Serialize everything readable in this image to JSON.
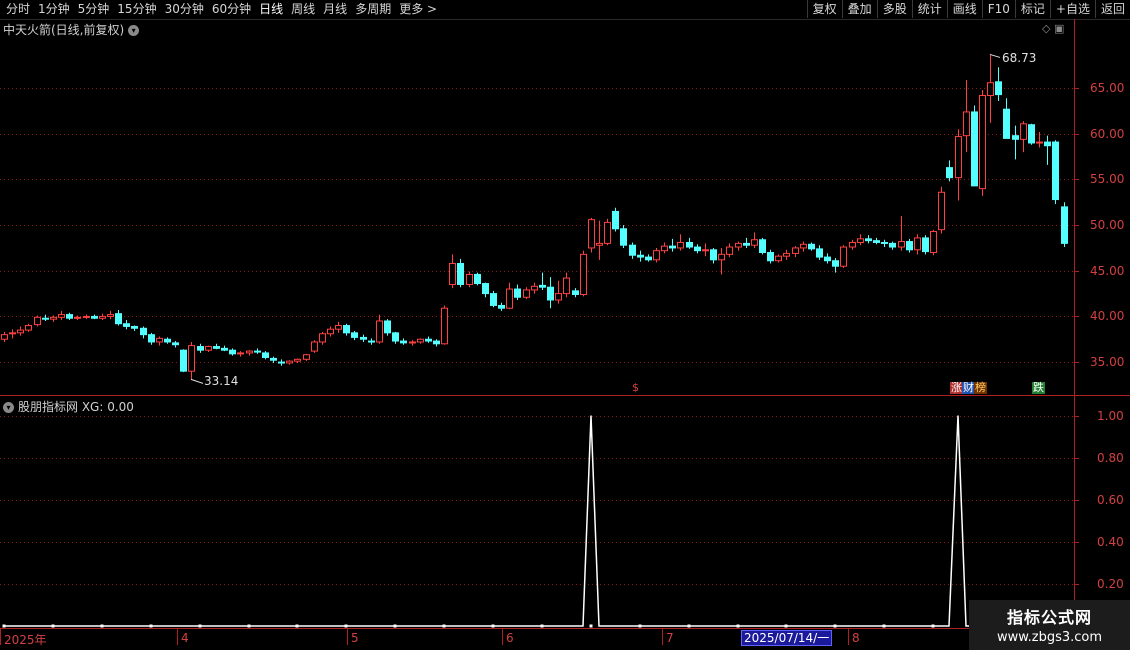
{
  "toolbar": {
    "periods": [
      "分时",
      "1分钟",
      "5分钟",
      "15分钟",
      "30分钟",
      "60分钟",
      "日线",
      "周线",
      "月线",
      "多周期",
      "更多 >"
    ],
    "active_period": "日线",
    "right_buttons": [
      "复权",
      "叠加",
      "多股",
      "统计",
      "画线",
      "F10",
      "标记",
      "+自选",
      "返回"
    ]
  },
  "main_chart": {
    "title": "中天火箭(日线,前复权)",
    "high_label": "68.73",
    "low_label": "33.14",
    "price_axis": [
      "65.00",
      "60.00",
      "55.00",
      "50.00",
      "45.00",
      "40.00",
      "35.00"
    ],
    "signals": [
      {
        "text": "$",
        "color": "#e04040"
      },
      {
        "text": "涨",
        "color": "#ffffff",
        "bg": "#b03030"
      },
      {
        "text": "财",
        "color": "#ffffff",
        "bg": "#2050b0"
      },
      {
        "text": "榜",
        "color": "#ffd060",
        "bg": "#703000"
      },
      {
        "text": "跌",
        "color": "#ffffff",
        "bg": "#208030"
      }
    ]
  },
  "indicator": {
    "title": "股朋指标网 XG: 0.00",
    "axis": [
      "1.00",
      "0.80",
      "0.60",
      "0.40",
      "0.20"
    ]
  },
  "x_axis": {
    "labels": [
      "2025年",
      "4",
      "5",
      "6",
      "7",
      "8"
    ],
    "cursor_date": "2025/07/14/一"
  },
  "watermark": {
    "line1": "指标公式网",
    "line2": "www.zbgs3.com"
  },
  "colors": {
    "up": "#ff4040",
    "down": "#54ffff",
    "grid": "#8a1a1a",
    "line": "#ffffff"
  },
  "chart_data": {
    "type": "candlestick",
    "ylim": [
      31.5,
      70.5
    ],
    "candles": [
      [
        37.5,
        38.3,
        37.2,
        38.0
      ],
      [
        38.1,
        38.6,
        37.6,
        38.2
      ],
      [
        38.2,
        38.9,
        37.9,
        38.5
      ],
      [
        38.5,
        39.2,
        38.3,
        39.0
      ],
      [
        39.1,
        40.1,
        38.9,
        39.9
      ],
      [
        39.8,
        40.2,
        39.5,
        39.7
      ],
      [
        39.7,
        40.1,
        39.4,
        39.9
      ],
      [
        39.9,
        40.6,
        39.6,
        40.2
      ],
      [
        40.2,
        40.4,
        39.6,
        39.8
      ],
      [
        39.8,
        40.1,
        39.6,
        39.9
      ],
      [
        39.9,
        40.2,
        39.7,
        40.0
      ],
      [
        40.0,
        40.2,
        39.7,
        39.8
      ],
      [
        39.8,
        40.3,
        39.6,
        40.0
      ],
      [
        40.0,
        40.6,
        39.7,
        40.2
      ],
      [
        40.3,
        40.7,
        39.0,
        39.2
      ],
      [
        39.2,
        39.6,
        38.6,
        38.9
      ],
      [
        38.9,
        39.0,
        38.4,
        38.7
      ],
      [
        38.7,
        38.9,
        37.6,
        38.0
      ],
      [
        38.0,
        38.2,
        36.9,
        37.2
      ],
      [
        37.2,
        37.8,
        36.8,
        37.6
      ],
      [
        37.5,
        37.7,
        37.0,
        37.2
      ],
      [
        37.1,
        37.3,
        36.6,
        36.9
      ],
      [
        36.3,
        36.4,
        33.9,
        34.0
      ],
      [
        34.0,
        37.2,
        33.1,
        36.8
      ],
      [
        36.7,
        37.0,
        36.0,
        36.3
      ],
      [
        36.3,
        36.8,
        36.1,
        36.7
      ],
      [
        36.7,
        37.0,
        36.4,
        36.5
      ],
      [
        36.5,
        36.8,
        36.2,
        36.3
      ],
      [
        36.3,
        36.5,
        35.7,
        35.9
      ],
      [
        35.9,
        36.2,
        35.6,
        36.0
      ],
      [
        36.0,
        36.3,
        35.7,
        36.2
      ],
      [
        36.2,
        36.5,
        35.9,
        36.1
      ],
      [
        36.0,
        36.2,
        35.3,
        35.5
      ],
      [
        35.4,
        35.6,
        34.9,
        35.2
      ],
      [
        35.0,
        35.3,
        34.6,
        34.9
      ],
      [
        34.9,
        35.2,
        34.7,
        35.1
      ],
      [
        35.1,
        35.4,
        34.9,
        35.3
      ],
      [
        35.3,
        35.9,
        35.1,
        35.8
      ],
      [
        36.2,
        37.4,
        36.0,
        37.2
      ],
      [
        37.2,
        38.3,
        36.9,
        38.1
      ],
      [
        38.1,
        38.9,
        37.8,
        38.6
      ],
      [
        38.6,
        39.4,
        38.2,
        39.0
      ],
      [
        39.0,
        39.2,
        37.9,
        38.2
      ],
      [
        38.2,
        38.4,
        37.4,
        37.7
      ],
      [
        37.7,
        38.0,
        37.2,
        37.5
      ],
      [
        37.3,
        37.6,
        36.9,
        37.2
      ],
      [
        37.2,
        40.2,
        37.0,
        39.5
      ],
      [
        39.5,
        39.7,
        37.9,
        38.2
      ],
      [
        38.2,
        38.3,
        37.0,
        37.3
      ],
      [
        37.3,
        37.6,
        36.9,
        37.1
      ],
      [
        37.1,
        37.4,
        36.8,
        37.2
      ],
      [
        37.2,
        37.6,
        37.0,
        37.5
      ],
      [
        37.5,
        37.8,
        37.1,
        37.3
      ],
      [
        37.3,
        37.5,
        36.7,
        37.0
      ],
      [
        37.0,
        41.2,
        36.9,
        40.9
      ],
      [
        43.5,
        46.8,
        43.1,
        45.8
      ],
      [
        45.8,
        46.3,
        43.2,
        43.5
      ],
      [
        43.5,
        44.9,
        43.2,
        44.6
      ],
      [
        44.6,
        44.8,
        43.4,
        43.6
      ],
      [
        43.6,
        43.7,
        42.1,
        42.5
      ],
      [
        42.5,
        42.8,
        41.0,
        41.2
      ],
      [
        41.2,
        41.5,
        40.6,
        40.9
      ],
      [
        40.9,
        43.7,
        40.8,
        43.0
      ],
      [
        43.0,
        43.5,
        41.8,
        42.1
      ],
      [
        42.1,
        43.2,
        41.9,
        42.9
      ],
      [
        42.9,
        43.7,
        42.5,
        43.3
      ],
      [
        43.4,
        44.8,
        42.9,
        43.2
      ],
      [
        43.2,
        44.3,
        40.9,
        41.8
      ],
      [
        41.8,
        43.9,
        41.4,
        42.5
      ],
      [
        42.5,
        44.8,
        42.1,
        44.2
      ],
      [
        42.8,
        43.1,
        42.1,
        42.4
      ],
      [
        42.4,
        47.2,
        42.2,
        46.8
      ],
      [
        47.5,
        50.8,
        47.0,
        50.6
      ],
      [
        47.8,
        50.5,
        46.2,
        48.0
      ],
      [
        48.0,
        50.7,
        47.8,
        50.3
      ],
      [
        51.5,
        51.9,
        49.3,
        49.6
      ],
      [
        49.6,
        50.0,
        47.5,
        47.8
      ],
      [
        47.8,
        48.1,
        46.3,
        46.7
      ],
      [
        46.7,
        47.2,
        46.0,
        46.5
      ],
      [
        46.5,
        46.8,
        46.0,
        46.2
      ],
      [
        46.2,
        47.5,
        45.9,
        47.2
      ],
      [
        47.2,
        48.1,
        46.9,
        47.7
      ],
      [
        47.7,
        48.5,
        47.1,
        47.5
      ],
      [
        47.5,
        49.0,
        47.2,
        48.1
      ],
      [
        48.1,
        48.6,
        47.4,
        47.6
      ],
      [
        47.6,
        47.9,
        46.9,
        47.2
      ],
      [
        47.2,
        48.0,
        46.6,
        47.3
      ],
      [
        47.3,
        47.5,
        45.8,
        46.2
      ],
      [
        46.2,
        47.5,
        44.6,
        46.8
      ],
      [
        46.8,
        48.0,
        46.5,
        47.6
      ],
      [
        47.6,
        48.2,
        47.2,
        48.0
      ],
      [
        48.0,
        48.6,
        47.5,
        47.8
      ],
      [
        47.8,
        49.2,
        47.5,
        48.4
      ],
      [
        48.4,
        48.6,
        46.8,
        47.0
      ],
      [
        47.0,
        47.3,
        45.8,
        46.1
      ],
      [
        46.1,
        46.8,
        45.9,
        46.6
      ],
      [
        46.6,
        47.3,
        46.2,
        46.9
      ],
      [
        46.9,
        47.7,
        46.5,
        47.5
      ],
      [
        47.5,
        48.2,
        47.1,
        47.9
      ],
      [
        47.9,
        48.1,
        47.2,
        47.4
      ],
      [
        47.4,
        47.8,
        46.2,
        46.5
      ],
      [
        46.5,
        46.9,
        45.8,
        46.1
      ],
      [
        46.1,
        46.4,
        44.8,
        45.5
      ],
      [
        45.5,
        47.8,
        45.3,
        47.6
      ],
      [
        47.6,
        48.4,
        47.3,
        48.1
      ],
      [
        48.1,
        49.0,
        47.8,
        48.5
      ],
      [
        48.5,
        48.9,
        48.0,
        48.3
      ],
      [
        48.3,
        48.6,
        47.9,
        48.1
      ],
      [
        48.1,
        48.4,
        47.6,
        48.0
      ],
      [
        48.0,
        48.2,
        47.3,
        47.6
      ],
      [
        47.6,
        51.0,
        47.2,
        48.2
      ],
      [
        48.2,
        48.5,
        47.0,
        47.3
      ],
      [
        47.3,
        49.0,
        46.8,
        48.6
      ],
      [
        48.6,
        48.9,
        46.8,
        47.1
      ],
      [
        47.0,
        49.5,
        46.7,
        49.3
      ],
      [
        49.5,
        54.2,
        49.1,
        53.6
      ],
      [
        56.3,
        57.1,
        54.8,
        55.2
      ],
      [
        55.2,
        60.5,
        52.7,
        59.7
      ],
      [
        59.8,
        65.9,
        58.0,
        62.4
      ],
      [
        62.4,
        63.1,
        55.0,
        54.3
      ],
      [
        54.0,
        64.8,
        53.2,
        64.2
      ],
      [
        64.2,
        68.7,
        61.2,
        65.6
      ],
      [
        65.7,
        67.3,
        63.6,
        64.3
      ],
      [
        62.7,
        63.9,
        59.6,
        59.5
      ],
      [
        59.8,
        60.9,
        57.2,
        59.4
      ],
      [
        59.4,
        61.4,
        58.0,
        61.1
      ],
      [
        61.0,
        61.1,
        58.8,
        59.0
      ],
      [
        59.0,
        60.2,
        58.5,
        59.1
      ],
      [
        59.1,
        59.8,
        56.6,
        58.7
      ],
      [
        59.1,
        59.3,
        52.3,
        52.8
      ],
      [
        52.0,
        52.5,
        47.6,
        48.0
      ]
    ],
    "indicator_series": {
      "name": "XG",
      "peaks_at_candle_index": [
        72,
        117
      ],
      "ylim": [
        0,
        1.05
      ]
    }
  }
}
